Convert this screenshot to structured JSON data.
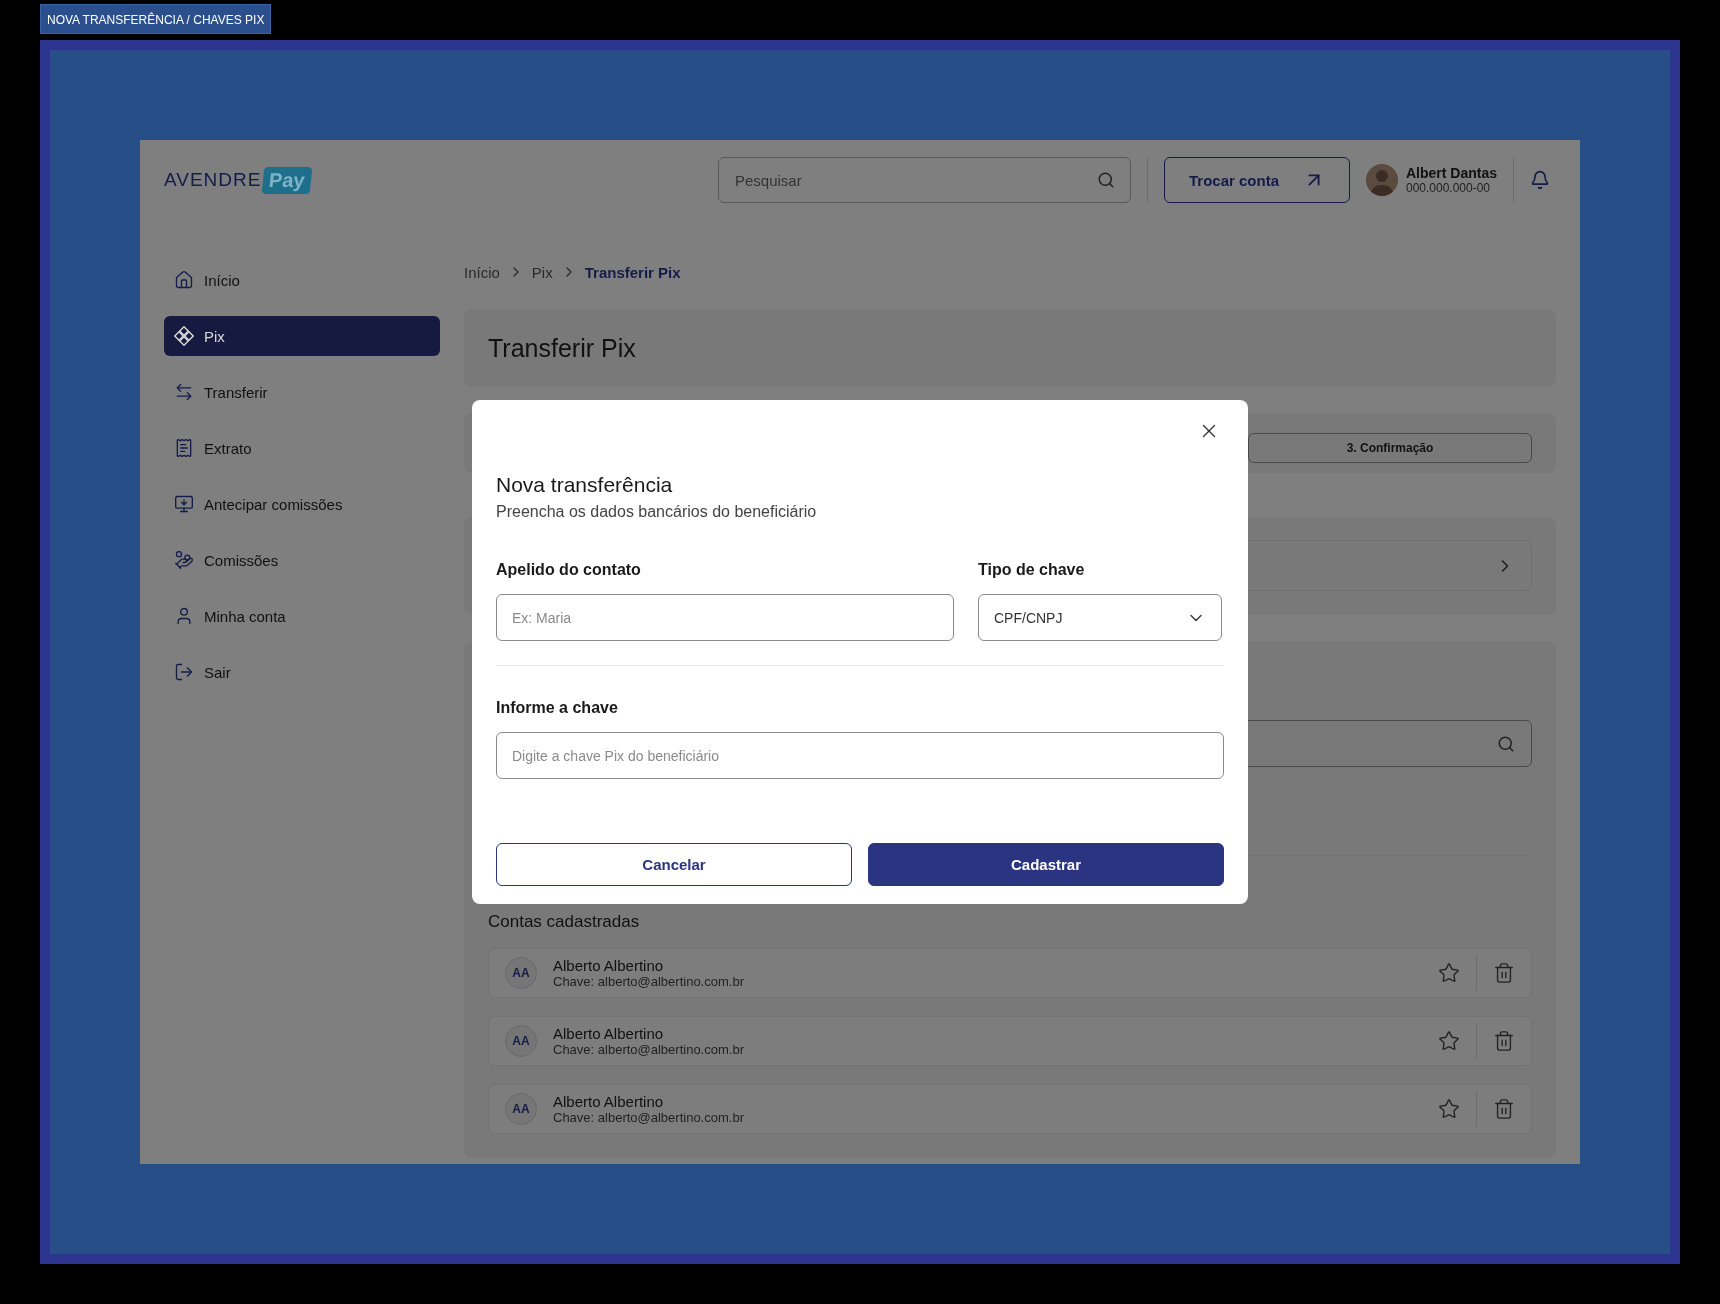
{
  "frame_label": "NOVA TRANSFERÊNCIA / CHAVES PIX",
  "header": {
    "logo": {
      "text": "AVENDRE",
      "badge": "Pay"
    },
    "search": {
      "placeholder": "Pesquisar"
    },
    "switch_account": "Trocar conta",
    "user": {
      "name": "Albert Dantas",
      "document": "000.000.000-00"
    }
  },
  "sidebar": {
    "items": [
      {
        "label": "Início",
        "kind": "home",
        "selected": false
      },
      {
        "label": "Pix",
        "kind": "pix",
        "selected": true
      },
      {
        "label": "Transferir",
        "kind": "transfer",
        "selected": false
      },
      {
        "label": "Extrato",
        "kind": "statement",
        "selected": false
      },
      {
        "label": "Antecipar comissões",
        "kind": "advance",
        "selected": false
      },
      {
        "label": "Comissões",
        "kind": "commissions",
        "selected": false
      },
      {
        "label": "Minha conta",
        "kind": "account",
        "selected": false
      },
      {
        "label": "Sair",
        "kind": "logout",
        "selected": false
      }
    ]
  },
  "breadcrumb": [
    {
      "label": "Início",
      "current": false
    },
    {
      "label": "Pix",
      "current": false
    },
    {
      "label": "Transferir Pix",
      "current": true
    }
  ],
  "page_title": "Transferir Pix",
  "stepper": {
    "step": "3. Confirmação"
  },
  "saved_accounts": {
    "title": "Contas cadastradas",
    "rows": [
      {
        "initials": "AA",
        "name": "Alberto Albertino",
        "key": "Chave: alberto@albertino.com.br"
      },
      {
        "initials": "AA",
        "name": "Alberto Albertino",
        "key": "Chave: alberto@albertino.com.br"
      },
      {
        "initials": "AA",
        "name": "Alberto Albertino",
        "key": "Chave: alberto@albertino.com.br"
      }
    ]
  },
  "modal": {
    "title": "Nova transferência",
    "subtitle": "Preencha os dados bancários do beneficiário",
    "nickname": {
      "label": "Apelido do contato",
      "placeholder": "Ex: Maria"
    },
    "key_type": {
      "label": "Tipo de chave",
      "value": "CPF/CNPJ"
    },
    "key": {
      "label": "Informe a chave",
      "placeholder": "Digite a chave Pix do beneficiário"
    },
    "buttons": {
      "cancel": "Cancelar",
      "submit": "Cadastrar"
    }
  }
}
